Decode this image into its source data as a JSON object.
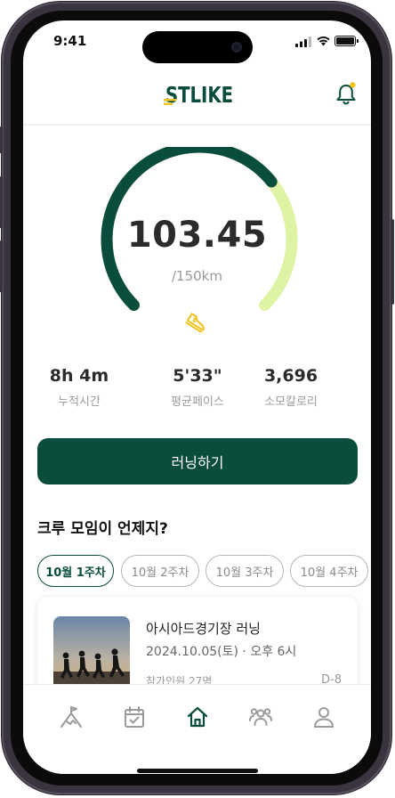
{
  "status_bar": {
    "time": "9:41"
  },
  "header": {
    "logo_text": "STLIKE"
  },
  "gauge": {
    "distance": "103.45",
    "goal": "/150km",
    "progress_fraction": 0.69,
    "track_color": "#dff3a4",
    "progress_color": "#0b4d3c"
  },
  "stats": [
    {
      "value": "8h 4m",
      "label": "누적시간"
    },
    {
      "value": "5'33\"",
      "label": "평균페이스"
    },
    {
      "value": "3,696",
      "label": "소모칼로리"
    }
  ],
  "run_button": {
    "label": "러닝하기"
  },
  "crew": {
    "title": "크루 모임이 언제지?",
    "weeks": [
      "10월 1주차",
      "10월 2주차",
      "10월 3주차",
      "10월 4주차"
    ],
    "selected_week": "10월 1주차"
  },
  "event": {
    "title": "아시아드경기장 러닝",
    "date": "2024.10.05(토) · 오후 6시",
    "participants": "참가인원 27명",
    "dday": "D-8"
  },
  "tabs": [
    "climb-icon",
    "calendar-check-icon",
    "home-icon",
    "people-icon",
    "person-icon"
  ],
  "colors": {
    "brand": "#0b4d3c",
    "accent": "#f2c318"
  }
}
